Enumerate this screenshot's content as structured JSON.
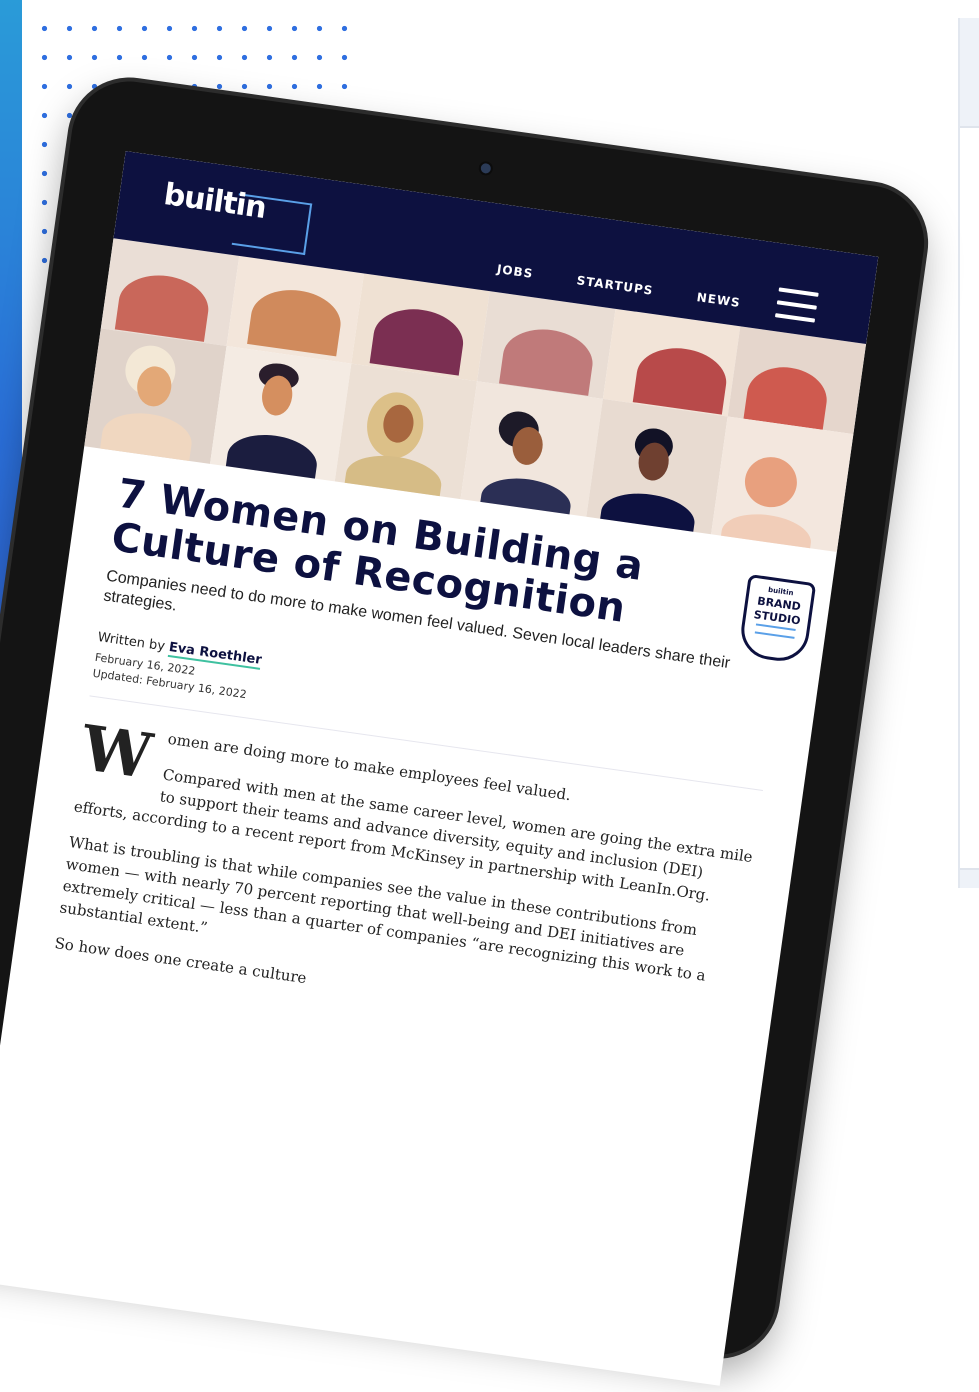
{
  "nav": {
    "logo": "builtin",
    "links": [
      "JOBS",
      "STARTUPS",
      "NEWS"
    ]
  },
  "badge": {
    "small": "builtin",
    "line1": "BRAND",
    "line2": "STUDIO"
  },
  "article": {
    "title": "7 Women on Building a Culture of Recognition",
    "subtitle": "Companies need to do more to make women feel valued. Seven local leaders share their strategies.",
    "written_by": "Written by",
    "author": "Eva Roethler",
    "date": "February 16, 2022",
    "updated": "Updated: February 16, 2022",
    "dropcap": "W",
    "first_line": "omen are doing more to make employees feel valued.",
    "p1": "Compared with men at the same career level, women are going the extra mile to support their teams and advance diversity, equity and inclusion (DEI) efforts, according to a recent report from McKinsey in partnership with LeanIn.Org.",
    "p2": "What is troubling is that while companies see the value in these contributions from women — with nearly 70 percent reporting that well-being and DEI initiatives are extremely critical — less than a quarter of companies “are recognizing this work to a substantial extent.”",
    "p3": "So how does one create a culture"
  }
}
